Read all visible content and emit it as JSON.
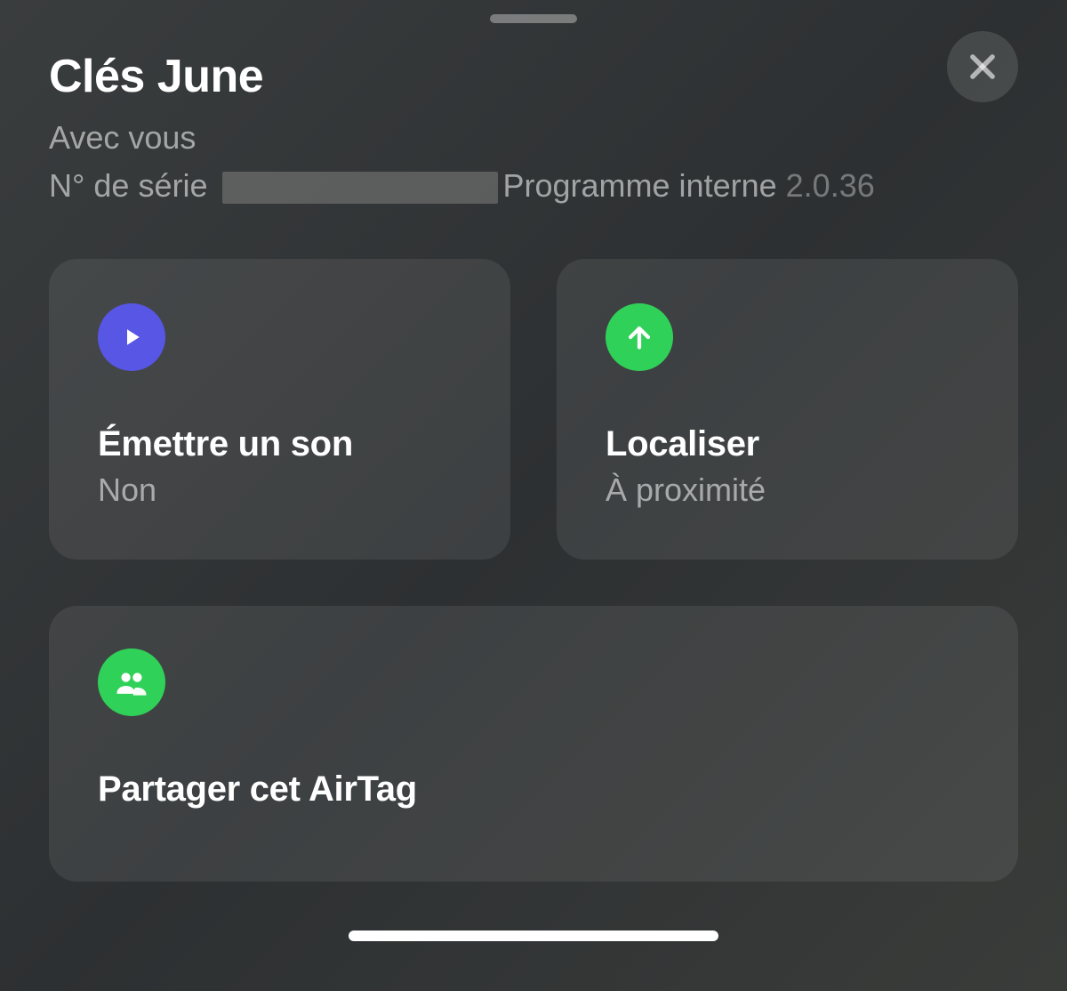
{
  "header": {
    "title": "Clés June",
    "status": "Avec vous",
    "serial_label": "N° de série",
    "firmware_label": "Programme interne",
    "firmware_version": "2.0.36"
  },
  "actions": {
    "play_sound": {
      "title": "Émettre un son",
      "subtitle": "Non"
    },
    "locate": {
      "title": "Localiser",
      "subtitle": "À proximité"
    },
    "share": {
      "title": "Partager cet AirTag"
    }
  }
}
